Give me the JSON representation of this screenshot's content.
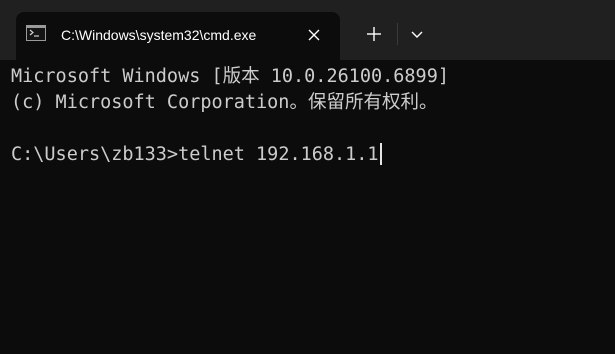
{
  "tab": {
    "icon": "terminal-icon",
    "title": "C:\\Windows\\system32\\cmd.exe",
    "close_icon": "close-icon"
  },
  "tabbar": {
    "new_tab_icon": "plus-icon",
    "dropdown_icon": "chevron-down-icon"
  },
  "terminal": {
    "lines": [
      "Microsoft Windows [版本 10.0.26100.6899]",
      "(c) Microsoft Corporation。保留所有权利。",
      ""
    ],
    "prompt": "C:\\Users\\zb133>",
    "command": "telnet 192.168.1.1"
  },
  "colors": {
    "tabbar_bg": "#202020",
    "terminal_bg": "#0c0c0c",
    "text": "#cccccc",
    "tab_title": "#ffffff"
  }
}
